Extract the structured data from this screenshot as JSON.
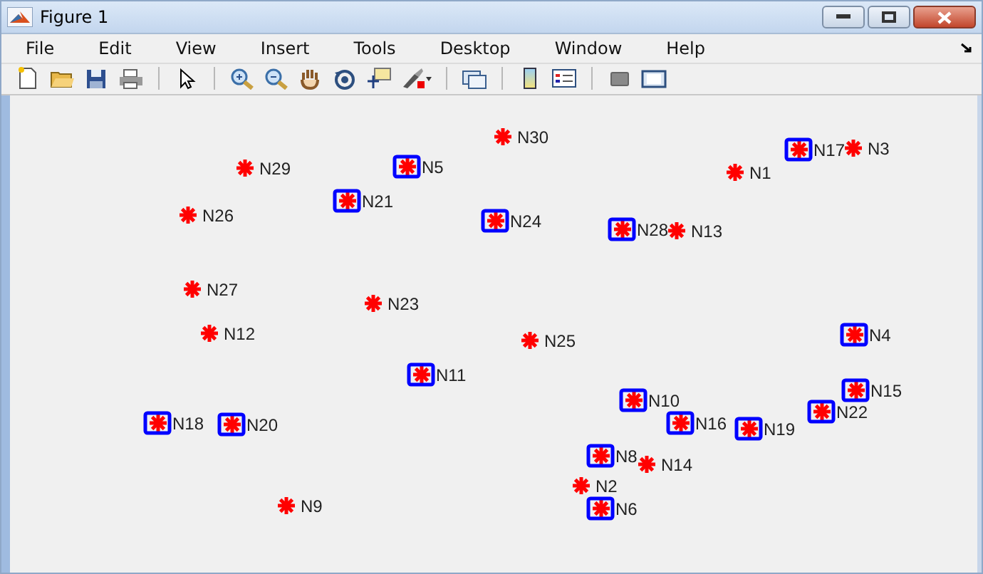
{
  "window": {
    "title": "Figure 1"
  },
  "menu": [
    "File",
    "Edit",
    "View",
    "Insert",
    "Tools",
    "Desktop",
    "Window",
    "Help"
  ],
  "plot": {
    "nodes": [
      {
        "label": "N30",
        "boxed": false
      },
      {
        "label": "N29",
        "boxed": false
      },
      {
        "label": "N5",
        "boxed": true
      },
      {
        "label": "N21",
        "boxed": true
      },
      {
        "label": "N26",
        "boxed": false
      },
      {
        "label": "N24",
        "boxed": true
      },
      {
        "label": "N13",
        "boxed": false
      },
      {
        "label": "N28",
        "boxed": true
      },
      {
        "label": "N17",
        "boxed": true
      },
      {
        "label": "N3",
        "boxed": false
      },
      {
        "label": "N1",
        "boxed": false
      },
      {
        "label": "N27",
        "boxed": false
      },
      {
        "label": "N23",
        "boxed": false
      },
      {
        "label": "N12",
        "boxed": false
      },
      {
        "label": "N25",
        "boxed": false
      },
      {
        "label": "N4",
        "boxed": true
      },
      {
        "label": "N11",
        "boxed": true
      },
      {
        "label": "N10",
        "boxed": true
      },
      {
        "label": "N15",
        "boxed": true
      },
      {
        "label": "N22",
        "boxed": true
      },
      {
        "label": "N16",
        "boxed": true
      },
      {
        "label": "N19",
        "boxed": true
      },
      {
        "label": "N18",
        "boxed": true
      },
      {
        "label": "N20",
        "boxed": true
      },
      {
        "label": "N14",
        "boxed": false
      },
      {
        "label": "N8",
        "boxed": true
      },
      {
        "label": "N2",
        "boxed": false
      },
      {
        "label": "N6",
        "boxed": true
      },
      {
        "label": "N9",
        "boxed": false
      }
    ]
  }
}
